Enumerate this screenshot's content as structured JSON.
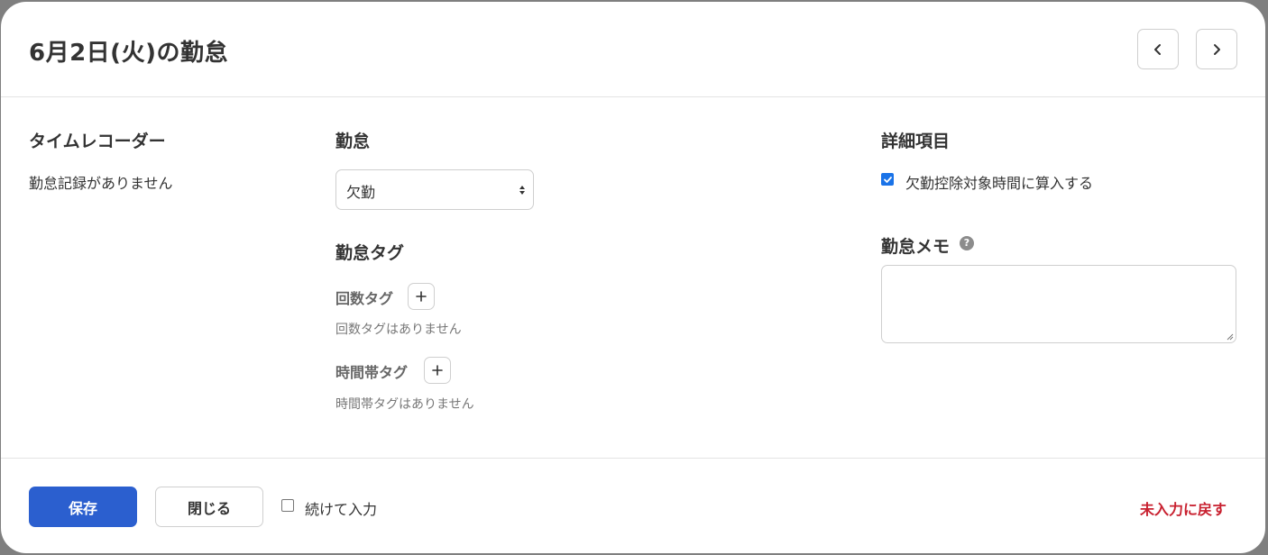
{
  "modal": {
    "title": "6月2日(火)の勤怠",
    "prev_icon": "chevron-left-icon",
    "next_icon": "chevron-right-icon"
  },
  "timerecorder": {
    "heading": "タイムレコーダー",
    "empty_text": "勤怠記録がありません"
  },
  "attendance": {
    "heading": "勤怠",
    "selected_value": "欠勤"
  },
  "tags": {
    "heading": "勤怠タグ",
    "count_tag_label": "回数タグ",
    "count_tag_empty": "回数タグはありません",
    "time_tag_label": "時間帯タグ",
    "time_tag_empty": "時間帯タグはありません",
    "add_icon": "plus-icon"
  },
  "details": {
    "heading": "詳細項目",
    "absence_deduction_checked": true,
    "absence_deduction_label": "欠勤控除対象時間に算入する"
  },
  "memo": {
    "heading": "勤怠メモ",
    "help_icon": "question-circle-icon",
    "help_glyph": "?",
    "value": ""
  },
  "footer": {
    "save_label": "保存",
    "close_label": "閉じる",
    "continue_checked": false,
    "continue_label": "続けて入力",
    "revert_label": "未入力に戻す"
  },
  "colors": {
    "primary": "#2b5fcf",
    "danger": "#c8202f",
    "checkbox": "#1a73e8"
  }
}
